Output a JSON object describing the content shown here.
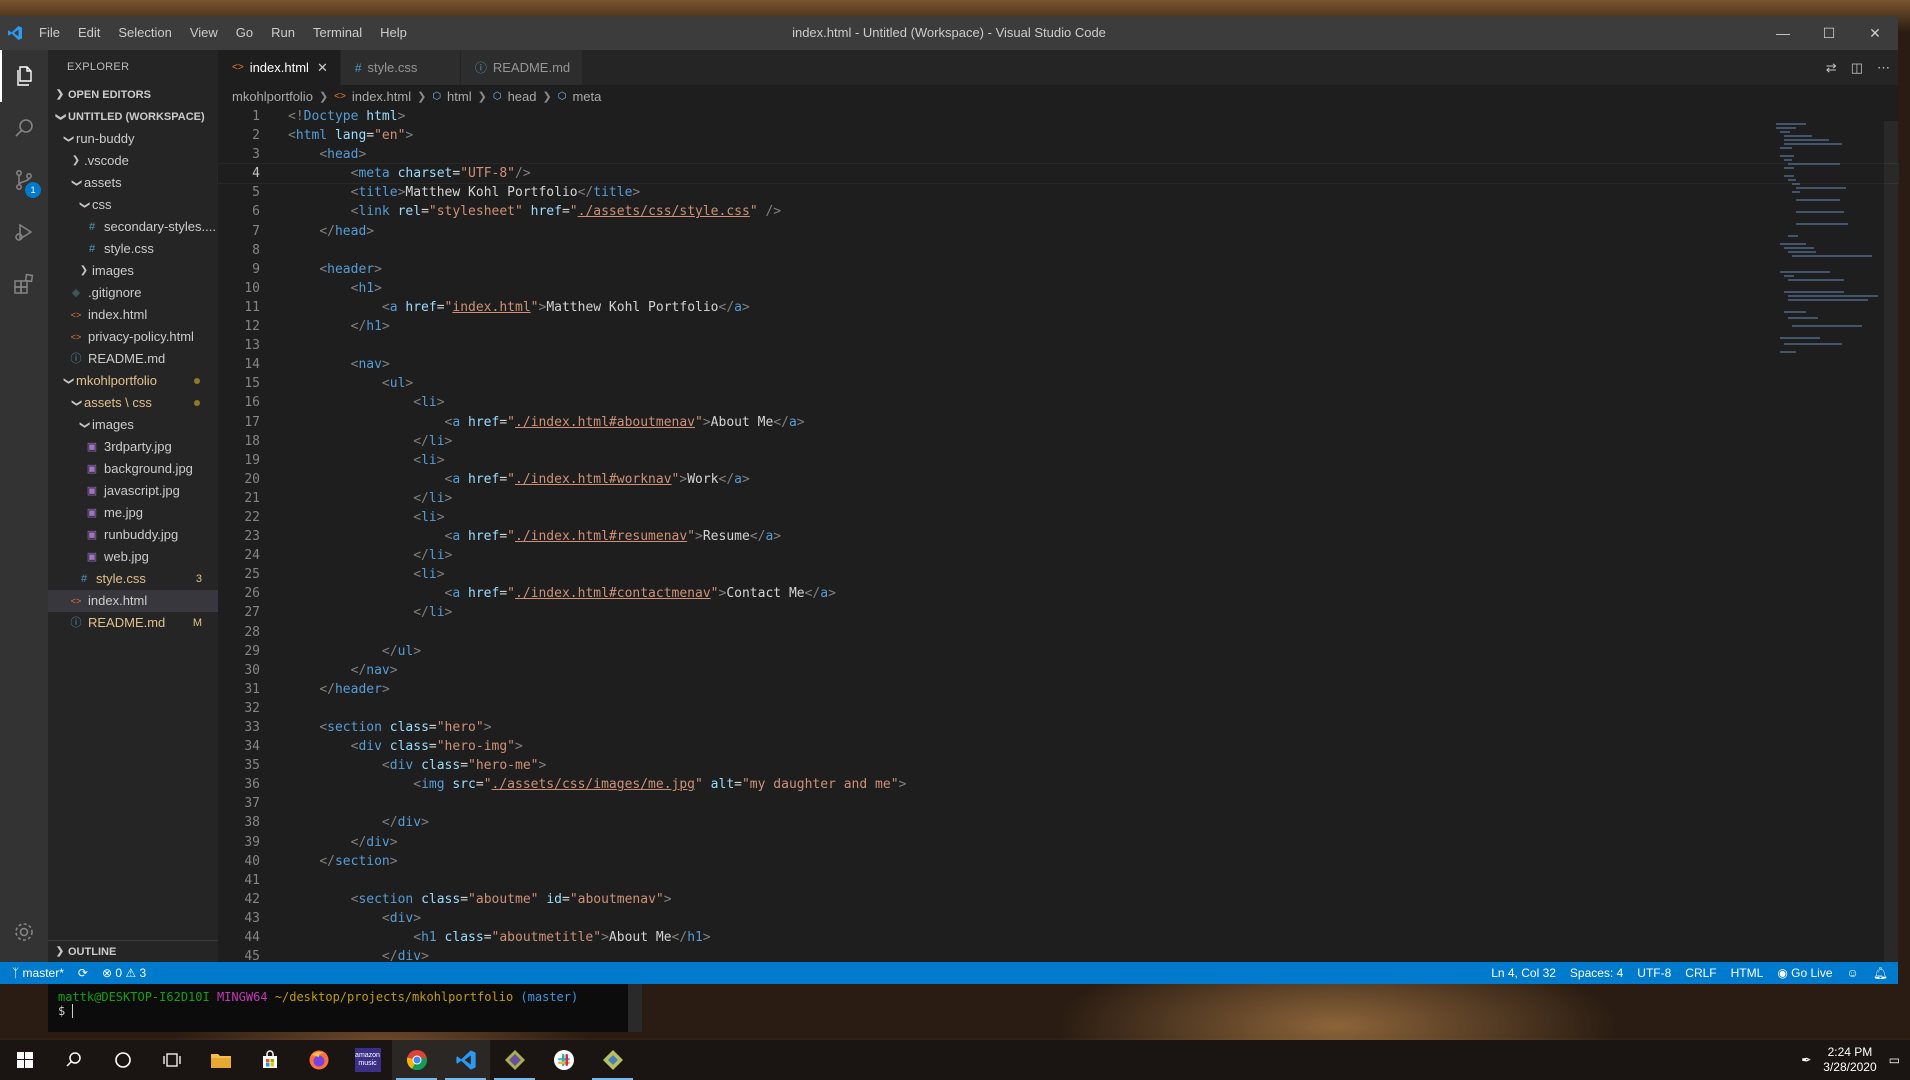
{
  "window": {
    "title": "index.html - Untitled (Workspace) - Visual Studio Code",
    "menu": [
      "File",
      "Edit",
      "Selection",
      "View",
      "Go",
      "Run",
      "Terminal",
      "Help"
    ]
  },
  "sidebar": {
    "title": "EXPLORER",
    "open_editors": "OPEN EDITORS",
    "workspace": "UNTITLED (WORKSPACE)",
    "outline": "OUTLINE",
    "tree": [
      {
        "label": "run-buddy",
        "indent": 1,
        "type": "folder-open",
        "color": ""
      },
      {
        "label": ".vscode",
        "indent": 2,
        "type": "folder-closed",
        "color": ""
      },
      {
        "label": "assets",
        "indent": 2,
        "type": "folder-open",
        "color": ""
      },
      {
        "label": "css",
        "indent": 3,
        "type": "folder-open",
        "color": ""
      },
      {
        "label": "secondary-styles....",
        "indent": 4,
        "type": "css",
        "color": ""
      },
      {
        "label": "style.css",
        "indent": 4,
        "type": "css",
        "color": ""
      },
      {
        "label": "images",
        "indent": 3,
        "type": "folder-closed",
        "color": ""
      },
      {
        "label": ".gitignore",
        "indent": 2,
        "type": "git",
        "color": ""
      },
      {
        "label": "index.html",
        "indent": 2,
        "type": "html",
        "color": ""
      },
      {
        "label": "privacy-policy.html",
        "indent": 2,
        "type": "html",
        "color": ""
      },
      {
        "label": "README.md",
        "indent": 2,
        "type": "info",
        "color": ""
      },
      {
        "label": "mkohlportfolio",
        "indent": 1,
        "type": "folder-open",
        "color": "mod",
        "dot": true
      },
      {
        "label": "assets \\ css",
        "indent": 2,
        "type": "folder-open",
        "color": "mod",
        "dot": true
      },
      {
        "label": "images",
        "indent": 3,
        "type": "folder-open",
        "color": ""
      },
      {
        "label": "3rdparty.jpg",
        "indent": 4,
        "type": "img",
        "color": ""
      },
      {
        "label": "background.jpg",
        "indent": 4,
        "type": "img",
        "color": ""
      },
      {
        "label": "javascript.jpg",
        "indent": 4,
        "type": "img",
        "color": ""
      },
      {
        "label": "me.jpg",
        "indent": 4,
        "type": "img",
        "color": ""
      },
      {
        "label": "runbuddy.jpg",
        "indent": 4,
        "type": "img",
        "color": ""
      },
      {
        "label": "web.jpg",
        "indent": 4,
        "type": "img",
        "color": ""
      },
      {
        "label": "style.css",
        "indent": 3,
        "type": "css",
        "color": "mod",
        "badge": "3"
      },
      {
        "label": "index.html",
        "indent": 2,
        "type": "html",
        "color": "",
        "selected": true
      },
      {
        "label": "README.md",
        "indent": 2,
        "type": "info",
        "color": "mod",
        "badge": "M"
      }
    ]
  },
  "tabs": [
    {
      "label": "index.html",
      "icon": "html",
      "active": true
    },
    {
      "label": "style.css",
      "icon": "css",
      "active": false
    },
    {
      "label": "README.md",
      "icon": "info",
      "active": false
    }
  ],
  "breadcrumb": [
    "mkohlportfolio",
    "index.html",
    "html",
    "head",
    "meta"
  ],
  "current_line": 4,
  "code_lines": [
    [
      [
        "t",
        "<!"
      ],
      [
        "k",
        "Doctype"
      ],
      [
        "p",
        " "
      ],
      [
        "a",
        "html"
      ],
      [
        "t",
        ">"
      ]
    ],
    [
      [
        "t",
        "<"
      ],
      [
        "k",
        "html"
      ],
      [
        "p",
        " "
      ],
      [
        "a",
        "lang"
      ],
      [
        "p",
        "="
      ],
      [
        "s",
        "\"en\""
      ],
      [
        "t",
        ">"
      ]
    ],
    [
      [
        "p",
        "    "
      ],
      [
        "t",
        "<"
      ],
      [
        "k",
        "head"
      ],
      [
        "t",
        ">"
      ]
    ],
    [
      [
        "p",
        "        "
      ],
      [
        "t",
        "<"
      ],
      [
        "k",
        "meta"
      ],
      [
        "p",
        " "
      ],
      [
        "a",
        "charset"
      ],
      [
        "p",
        "="
      ],
      [
        "s",
        "\"UTF-8\""
      ],
      [
        "t",
        "/>"
      ]
    ],
    [
      [
        "p",
        "        "
      ],
      [
        "t",
        "<"
      ],
      [
        "k",
        "title"
      ],
      [
        "t",
        ">"
      ],
      [
        "p",
        "Matthew Kohl Portfolio"
      ],
      [
        "t",
        "</"
      ],
      [
        "k",
        "title"
      ],
      [
        "t",
        ">"
      ]
    ],
    [
      [
        "p",
        "        "
      ],
      [
        "t",
        "<"
      ],
      [
        "k",
        "link"
      ],
      [
        "p",
        " "
      ],
      [
        "a",
        "rel"
      ],
      [
        "p",
        "="
      ],
      [
        "s",
        "\"stylesheet\""
      ],
      [
        "p",
        " "
      ],
      [
        "a",
        "href"
      ],
      [
        "p",
        "="
      ],
      [
        "s",
        "\""
      ],
      [
        "u",
        "./assets/css/style.css"
      ],
      [
        "s",
        "\""
      ],
      [
        "p",
        " "
      ],
      [
        "t",
        "/>"
      ]
    ],
    [
      [
        "p",
        "    "
      ],
      [
        "t",
        "</"
      ],
      [
        "k",
        "head"
      ],
      [
        "t",
        ">"
      ]
    ],
    [],
    [
      [
        "p",
        "    "
      ],
      [
        "t",
        "<"
      ],
      [
        "k",
        "header"
      ],
      [
        "t",
        ">"
      ]
    ],
    [
      [
        "p",
        "        "
      ],
      [
        "t",
        "<"
      ],
      [
        "k",
        "h1"
      ],
      [
        "t",
        ">"
      ]
    ],
    [
      [
        "p",
        "            "
      ],
      [
        "t",
        "<"
      ],
      [
        "k",
        "a"
      ],
      [
        "p",
        " "
      ],
      [
        "a",
        "href"
      ],
      [
        "p",
        "="
      ],
      [
        "s",
        "\""
      ],
      [
        "u",
        "index.html"
      ],
      [
        "s",
        "\""
      ],
      [
        "t",
        ">"
      ],
      [
        "p",
        "Matthew Kohl Portfolio"
      ],
      [
        "t",
        "</"
      ],
      [
        "k",
        "a"
      ],
      [
        "t",
        ">"
      ]
    ],
    [
      [
        "p",
        "        "
      ],
      [
        "t",
        "</"
      ],
      [
        "k",
        "h1"
      ],
      [
        "t",
        ">"
      ]
    ],
    [],
    [
      [
        "p",
        "        "
      ],
      [
        "t",
        "<"
      ],
      [
        "k",
        "nav"
      ],
      [
        "t",
        ">"
      ]
    ],
    [
      [
        "p",
        "            "
      ],
      [
        "t",
        "<"
      ],
      [
        "k",
        "ul"
      ],
      [
        "t",
        ">"
      ]
    ],
    [
      [
        "p",
        "                "
      ],
      [
        "t",
        "<"
      ],
      [
        "k",
        "li"
      ],
      [
        "t",
        ">"
      ]
    ],
    [
      [
        "p",
        "                    "
      ],
      [
        "t",
        "<"
      ],
      [
        "k",
        "a"
      ],
      [
        "p",
        " "
      ],
      [
        "a",
        "href"
      ],
      [
        "p",
        "="
      ],
      [
        "s",
        "\""
      ],
      [
        "u",
        "./index.html#aboutmenav"
      ],
      [
        "s",
        "\""
      ],
      [
        "t",
        ">"
      ],
      [
        "p",
        "About Me"
      ],
      [
        "t",
        "</"
      ],
      [
        "k",
        "a"
      ],
      [
        "t",
        ">"
      ]
    ],
    [
      [
        "p",
        "                "
      ],
      [
        "t",
        "</"
      ],
      [
        "k",
        "li"
      ],
      [
        "t",
        ">"
      ]
    ],
    [
      [
        "p",
        "                "
      ],
      [
        "t",
        "<"
      ],
      [
        "k",
        "li"
      ],
      [
        "t",
        ">"
      ]
    ],
    [
      [
        "p",
        "                    "
      ],
      [
        "t",
        "<"
      ],
      [
        "k",
        "a"
      ],
      [
        "p",
        " "
      ],
      [
        "a",
        "href"
      ],
      [
        "p",
        "="
      ],
      [
        "s",
        "\""
      ],
      [
        "u",
        "./index.html#worknav"
      ],
      [
        "s",
        "\""
      ],
      [
        "t",
        ">"
      ],
      [
        "p",
        "Work"
      ],
      [
        "t",
        "</"
      ],
      [
        "k",
        "a"
      ],
      [
        "t",
        ">"
      ]
    ],
    [
      [
        "p",
        "                "
      ],
      [
        "t",
        "</"
      ],
      [
        "k",
        "li"
      ],
      [
        "t",
        ">"
      ]
    ],
    [
      [
        "p",
        "                "
      ],
      [
        "t",
        "<"
      ],
      [
        "k",
        "li"
      ],
      [
        "t",
        ">"
      ]
    ],
    [
      [
        "p",
        "                    "
      ],
      [
        "t",
        "<"
      ],
      [
        "k",
        "a"
      ],
      [
        "p",
        " "
      ],
      [
        "a",
        "href"
      ],
      [
        "p",
        "="
      ],
      [
        "s",
        "\""
      ],
      [
        "u",
        "./index.html#resumenav"
      ],
      [
        "s",
        "\""
      ],
      [
        "t",
        ">"
      ],
      [
        "p",
        "Resume"
      ],
      [
        "t",
        "</"
      ],
      [
        "k",
        "a"
      ],
      [
        "t",
        ">"
      ]
    ],
    [
      [
        "p",
        "                "
      ],
      [
        "t",
        "</"
      ],
      [
        "k",
        "li"
      ],
      [
        "t",
        ">"
      ]
    ],
    [
      [
        "p",
        "                "
      ],
      [
        "t",
        "<"
      ],
      [
        "k",
        "li"
      ],
      [
        "t",
        ">"
      ]
    ],
    [
      [
        "p",
        "                    "
      ],
      [
        "t",
        "<"
      ],
      [
        "k",
        "a"
      ],
      [
        "p",
        " "
      ],
      [
        "a",
        "href"
      ],
      [
        "p",
        "="
      ],
      [
        "s",
        "\""
      ],
      [
        "u",
        "./index.html#contactmenav"
      ],
      [
        "s",
        "\""
      ],
      [
        "t",
        ">"
      ],
      [
        "p",
        "Contact Me"
      ],
      [
        "t",
        "</"
      ],
      [
        "k",
        "a"
      ],
      [
        "t",
        ">"
      ]
    ],
    [
      [
        "p",
        "                "
      ],
      [
        "t",
        "</"
      ],
      [
        "k",
        "li"
      ],
      [
        "t",
        ">"
      ]
    ],
    [],
    [
      [
        "p",
        "            "
      ],
      [
        "t",
        "</"
      ],
      [
        "k",
        "ul"
      ],
      [
        "t",
        ">"
      ]
    ],
    [
      [
        "p",
        "        "
      ],
      [
        "t",
        "</"
      ],
      [
        "k",
        "nav"
      ],
      [
        "t",
        ">"
      ]
    ],
    [
      [
        "p",
        "    "
      ],
      [
        "t",
        "</"
      ],
      [
        "k",
        "header"
      ],
      [
        "t",
        ">"
      ]
    ],
    [],
    [
      [
        "p",
        "    "
      ],
      [
        "t",
        "<"
      ],
      [
        "k",
        "section"
      ],
      [
        "p",
        " "
      ],
      [
        "a",
        "class"
      ],
      [
        "p",
        "="
      ],
      [
        "s",
        "\"hero\""
      ],
      [
        "t",
        ">"
      ]
    ],
    [
      [
        "p",
        "        "
      ],
      [
        "t",
        "<"
      ],
      [
        "k",
        "div"
      ],
      [
        "p",
        " "
      ],
      [
        "a",
        "class"
      ],
      [
        "p",
        "="
      ],
      [
        "s",
        "\"hero-img\""
      ],
      [
        "t",
        ">"
      ]
    ],
    [
      [
        "p",
        "            "
      ],
      [
        "t",
        "<"
      ],
      [
        "k",
        "div"
      ],
      [
        "p",
        " "
      ],
      [
        "a",
        "class"
      ],
      [
        "p",
        "="
      ],
      [
        "s",
        "\"hero-me\""
      ],
      [
        "t",
        ">"
      ]
    ],
    [
      [
        "p",
        "                "
      ],
      [
        "t",
        "<"
      ],
      [
        "k",
        "img"
      ],
      [
        "p",
        " "
      ],
      [
        "a",
        "src"
      ],
      [
        "p",
        "="
      ],
      [
        "s",
        "\""
      ],
      [
        "u",
        "./assets/css/images/me.jpg"
      ],
      [
        "s",
        "\""
      ],
      [
        "p",
        " "
      ],
      [
        "a",
        "alt"
      ],
      [
        "p",
        "="
      ],
      [
        "s",
        "\"my daughter and me\""
      ],
      [
        "t",
        ">"
      ]
    ],
    [],
    [
      [
        "p",
        "            "
      ],
      [
        "t",
        "</"
      ],
      [
        "k",
        "div"
      ],
      [
        "t",
        ">"
      ]
    ],
    [
      [
        "p",
        "        "
      ],
      [
        "t",
        "</"
      ],
      [
        "k",
        "div"
      ],
      [
        "t",
        ">"
      ]
    ],
    [
      [
        "p",
        "    "
      ],
      [
        "t",
        "</"
      ],
      [
        "k",
        "section"
      ],
      [
        "t",
        ">"
      ]
    ],
    [],
    [
      [
        "p",
        "        "
      ],
      [
        "t",
        "<"
      ],
      [
        "k",
        "section"
      ],
      [
        "p",
        " "
      ],
      [
        "a",
        "class"
      ],
      [
        "p",
        "="
      ],
      [
        "s",
        "\"aboutme\""
      ],
      [
        "p",
        " "
      ],
      [
        "a",
        "id"
      ],
      [
        "p",
        "="
      ],
      [
        "s",
        "\"aboutmenav\""
      ],
      [
        "t",
        ">"
      ]
    ],
    [
      [
        "p",
        "            "
      ],
      [
        "t",
        "<"
      ],
      [
        "k",
        "div"
      ],
      [
        "t",
        ">"
      ]
    ],
    [
      [
        "p",
        "                "
      ],
      [
        "t",
        "<"
      ],
      [
        "k",
        "h1"
      ],
      [
        "p",
        " "
      ],
      [
        "a",
        "class"
      ],
      [
        "p",
        "="
      ],
      [
        "s",
        "\"aboutmetitle\""
      ],
      [
        "t",
        ">"
      ],
      [
        "p",
        "About Me"
      ],
      [
        "t",
        "</"
      ],
      [
        "k",
        "h1"
      ],
      [
        "t",
        ">"
      ]
    ],
    [
      [
        "p",
        "            "
      ],
      [
        "t",
        "</"
      ],
      [
        "k",
        "div"
      ],
      [
        "t",
        ">"
      ]
    ]
  ],
  "syntax_colors": {
    "t": "#808080",
    "k": "#569cd6",
    "a": "#9cdcfe",
    "s": "#ce9178",
    "u": "#ce9178",
    "p": "#d4d4d4"
  },
  "status": {
    "branch": "master*",
    "errors": "0",
    "warnings": "3",
    "position": "Ln 4, Col 32",
    "spaces": "Spaces: 4",
    "encoding": "UTF-8",
    "eol": "CRLF",
    "language": "HTML",
    "golive": "Go Live"
  },
  "terminal": {
    "user": "mattk@DESKTOP-I62D10I",
    "env": "MINGW64",
    "path": "~/desktop/projects/mkohlportfolio",
    "branch": "(master)",
    "prompt": "$"
  },
  "taskbar": {
    "time": "2:24 PM",
    "date": "3/28/2020",
    "amazon_label": "amazon music"
  }
}
